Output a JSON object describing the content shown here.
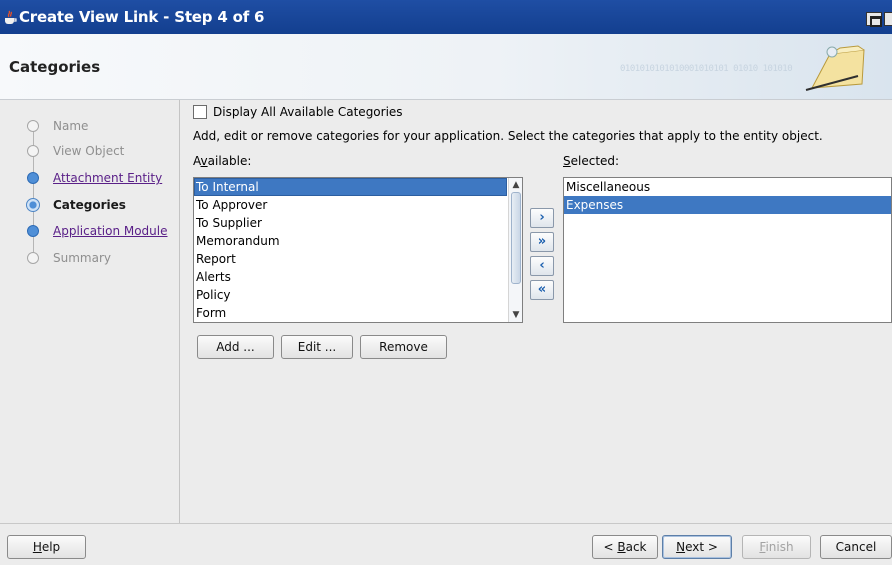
{
  "window": {
    "title": "Create View Link - Step 4 of 6"
  },
  "header": {
    "page_title": "Categories",
    "binary_text": "0101010101010001010101 01010 101010"
  },
  "nav": {
    "items": [
      {
        "label": "Name",
        "state": "disabled"
      },
      {
        "label": "View Object",
        "state": "disabled"
      },
      {
        "label": "Attachment Entity",
        "state": "link"
      },
      {
        "label": "Categories",
        "state": "current"
      },
      {
        "label": "Application Module",
        "state": "link"
      },
      {
        "label": "Summary",
        "state": "disabled"
      }
    ]
  },
  "main": {
    "display_all_label": "Display All Available Categories",
    "display_all_checked": false,
    "description": "Add, edit or remove categories for your application. Select the categories that apply to the entity object.",
    "available_label_pre": "A",
    "available_label_mnemonic": "v",
    "available_label_post": "ailable:",
    "selected_label_mnemonic": "S",
    "selected_label_post": "elected:",
    "available_items": [
      "To Internal",
      "To Approver",
      "To Supplier",
      "Memorandum",
      "Report",
      "Alerts",
      "Policy",
      "Form"
    ],
    "available_selected": "To Internal",
    "selected_items": [
      "Miscellaneous",
      "Expenses"
    ],
    "selected_selected": "Expenses",
    "shuttle": {
      "move_right": "›",
      "move_all_right": "»",
      "move_left": "‹",
      "move_all_left": "«"
    },
    "buttons": {
      "add": "Add ...",
      "edit": "Edit ...",
      "remove": "Remove"
    }
  },
  "footer": {
    "help_mnemonic": "H",
    "help_post": "elp",
    "back_pre": "< ",
    "back_mnemonic": "B",
    "back_post": "ack",
    "next_mnemonic": "N",
    "next_post": "ext >",
    "finish_mnemonic": "F",
    "finish_post": "inish",
    "cancel": "Cancel"
  },
  "colors": {
    "titlebar": "#1f4ea4",
    "selection": "#3e78c2",
    "link": "#5a2088"
  }
}
